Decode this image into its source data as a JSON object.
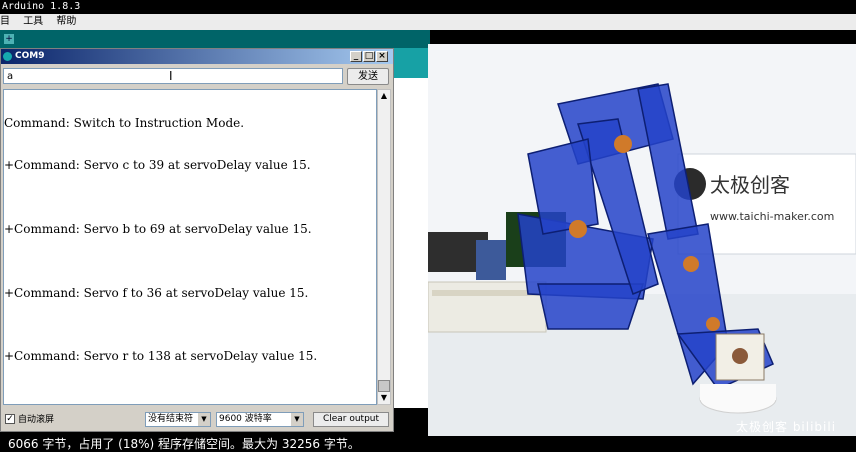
{
  "window": {
    "title": "Arduino 1.8.3",
    "menu": [
      "目",
      "工具",
      "帮助"
    ]
  },
  "serial_monitor": {
    "title": "COM9",
    "input_value": "a",
    "send_label": "发送",
    "output_lines": [
      "Command: Switch to Instruction Mode.",
      "+Command: Servo c to 39 at servoDelay value 15.",
      "+Command: Servo b to 69 at servoDelay value 15.",
      "+Command: Servo f to 36 at servoDelay value 15.",
      "+Command: Servo r to 138 at servoDelay value 15."
    ],
    "autoscroll_label": "自动滚屏",
    "autoscroll_checked": true,
    "line_ending": "没有结束符",
    "baud_rate": "9600 波特率",
    "clear_label": "Clear output"
  },
  "console": {
    "message": "6066 字节，占用了 (18%) 程序存储空间。最大为 32256 字节。"
  },
  "camera": {
    "sign_text": "太极创客",
    "sign_url": "www.taichi-maker.com",
    "watermark": "太极创客 bilibili"
  },
  "colors": {
    "ide_teal": "#006468",
    "ide_tab": "#17a1a5",
    "robot_blue": "#1e3fb8"
  }
}
